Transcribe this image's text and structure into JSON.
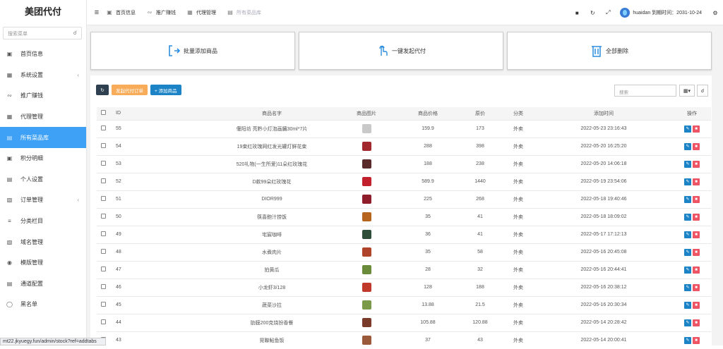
{
  "sidebar": {
    "logo": "美团代付",
    "search_placeholder": "搜索菜单",
    "items": [
      {
        "label": "首页信息",
        "icon": "monitor-icon",
        "arrow": false
      },
      {
        "label": "系统设置",
        "icon": "settings-screen-icon",
        "arrow": true
      },
      {
        "label": "推广赚钱",
        "icon": "promo-icon",
        "arrow": false
      },
      {
        "label": "代理管理",
        "icon": "agent-icon",
        "arrow": false
      },
      {
        "label": "所有菜品库",
        "icon": "dishes-icon",
        "arrow": false,
        "active": true
      },
      {
        "label": "积分明细",
        "icon": "points-icon",
        "arrow": false
      },
      {
        "label": "个人设置",
        "icon": "profile-icon",
        "arrow": false
      },
      {
        "label": "订单管理",
        "icon": "order-icon",
        "arrow": true
      },
      {
        "label": "分类栏目",
        "icon": "category-icon",
        "arrow": false
      },
      {
        "label": "域名管理",
        "icon": "domain-icon",
        "arrow": false
      },
      {
        "label": "模版管理",
        "icon": "template-icon",
        "arrow": false
      },
      {
        "label": "通道配置",
        "icon": "channel-icon",
        "arrow": false
      },
      {
        "label": "黑名单",
        "icon": "blacklist-icon",
        "arrow": false
      }
    ]
  },
  "status_url": "mt22.jkyuegy.fun/admin/stock?ref=addtabs",
  "topbar": {
    "tabs": [
      {
        "label": "首页信息"
      },
      {
        "label": "推广赚钱"
      },
      {
        "label": "代理管理"
      },
      {
        "label": "所有菜品库"
      }
    ],
    "user_text": "huaidan 到期时间：2031-10-24"
  },
  "cards": [
    {
      "label": "批量添加商品",
      "icon": "batch-add-icon"
    },
    {
      "label": "一键发起代付",
      "icon": "tap-pay-icon"
    },
    {
      "label": "全部删除",
      "icon": "trash-icon"
    }
  ],
  "toolbar": {
    "init_button": "发起代付订单",
    "add_button": "+ 添加商品"
  },
  "search": {
    "placeholder": "搜索"
  },
  "table": {
    "headers": [
      "ID",
      "商品名字",
      "商品图片",
      "商品价格",
      "原价",
      "分类",
      "添加时间",
      "操作"
    ],
    "rows": [
      {
        "id": "55",
        "name": "偃阳坊 亮黔小灯泡画臓30ml*7片",
        "price": "159.9",
        "orig": "173",
        "cat": "外卖",
        "time": "2022-05-23 23:16:43",
        "img": "#c9c9c9"
      },
      {
        "id": "54",
        "name": "19束红玫瑰网红发光罐灯鲜花束",
        "price": "288",
        "orig": "398",
        "cat": "外卖",
        "time": "2022-05-20 16:25:20",
        "img": "#a3282e"
      },
      {
        "id": "53",
        "name": "520礼物(一生所爱)11朵红玫瑰花",
        "price": "188",
        "orig": "238",
        "cat": "外卖",
        "time": "2022-05-20 14:06:18",
        "img": "#5b2a2a"
      },
      {
        "id": "52",
        "name": "D款99朵红玫瑰花",
        "price": "589.9",
        "orig": "1440",
        "cat": "外卖",
        "time": "2022-05-19 23:54:06",
        "img": "#c3202e"
      },
      {
        "id": "51",
        "name": "DIOR999",
        "price": "225",
        "orig": "268",
        "cat": "外卖",
        "time": "2022-05-18 19:40:46",
        "img": "#8e1c2a"
      },
      {
        "id": "50",
        "name": "筷喜鲍汁捞饭",
        "price": "35",
        "orig": "41",
        "cat": "外卖",
        "time": "2022-05-18 18:09:02",
        "img": "#b5651d"
      },
      {
        "id": "49",
        "name": "宅宸咖啡",
        "price": "36",
        "orig": "41",
        "cat": "外卖",
        "time": "2022-05-17 17:12:13",
        "img": "#2e4e3a"
      },
      {
        "id": "48",
        "name": "水煮肉片",
        "price": "35",
        "orig": "58",
        "cat": "外卖",
        "time": "2022-05-16 20:45:08",
        "img": "#b0442a"
      },
      {
        "id": "47",
        "name": "拍黄瓜",
        "price": "28",
        "orig": "32",
        "cat": "外卖",
        "time": "2022-05-16 20:44:41",
        "img": "#6a8c3a"
      },
      {
        "id": "46",
        "name": "小龙虾3/128",
        "price": "128",
        "orig": "188",
        "cat": "外卖",
        "time": "2022-05-16 20:38:12",
        "img": "#c0392b"
      },
      {
        "id": "45",
        "name": "蔬菜沙拉",
        "price": "13.88",
        "orig": "21.5",
        "cat": "外卖",
        "time": "2022-05-16 20:30:34",
        "img": "#7a9a4a"
      },
      {
        "id": "44",
        "name": "肋膜200克烧扮香餐",
        "price": "105.88",
        "orig": "120.88",
        "cat": "外卖",
        "time": "2022-05-14 20:28:42",
        "img": "#7a3b2b"
      },
      {
        "id": "43",
        "name": "晃聯鮎鱼饭",
        "price": "37",
        "orig": "43",
        "cat": "外卖",
        "time": "2022-05-14 20:00:41",
        "img": "#9a5a3a"
      }
    ]
  }
}
